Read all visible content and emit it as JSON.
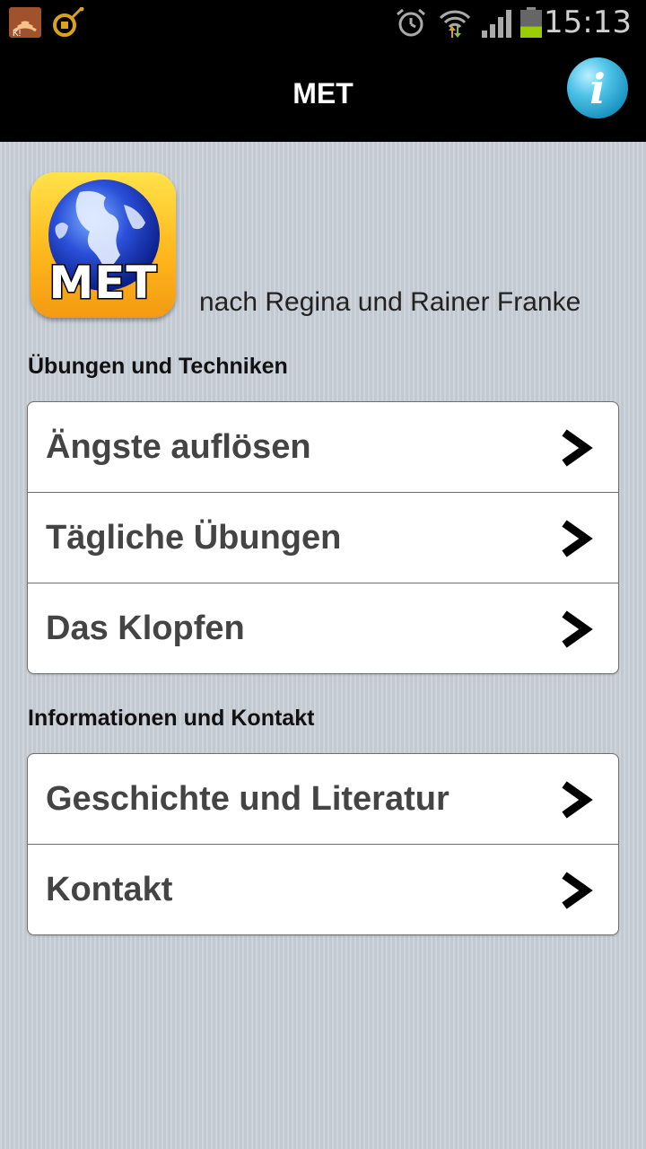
{
  "status_bar": {
    "time": "15:13",
    "icons": [
      "wifi-icon",
      "satellite-icon",
      "alarm-icon",
      "wifi-data-icon",
      "signal-icon",
      "battery-icon"
    ],
    "battery_level": 0.4
  },
  "header": {
    "title": "MET",
    "info_icon": "info-icon"
  },
  "logo": {
    "text": "MET",
    "icon": "globe-icon"
  },
  "subtitle": "nach Regina und Rainer Franke",
  "sections": [
    {
      "heading": "Übungen und Techniken",
      "items": [
        {
          "label": "Ängste auflösen"
        },
        {
          "label": "Tägliche Übungen"
        },
        {
          "label": "Das Klopfen"
        }
      ]
    },
    {
      "heading": "Informationen und Kontakt",
      "items": [
        {
          "label": "Geschichte und Literatur"
        },
        {
          "label": "Kontakt"
        }
      ]
    }
  ],
  "colors": {
    "header_bg": "#000000",
    "page_bg": "#c9cfd8",
    "item_text": "#444444",
    "info_button": "#4fc3e8",
    "logo_bg": "#ffb81c"
  }
}
